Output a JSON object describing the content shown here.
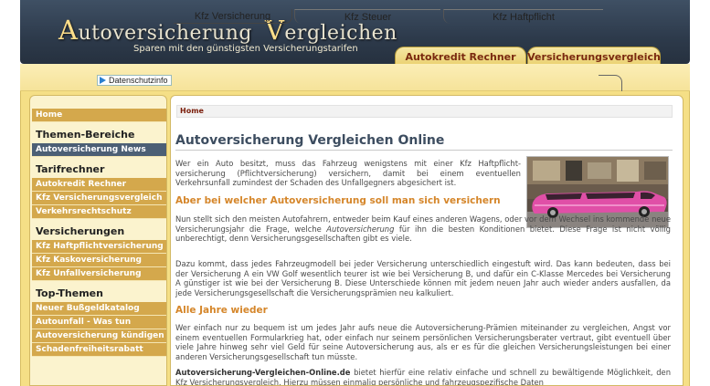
{
  "header": {
    "logo_title_a_initial": "A",
    "logo_title_a_rest": "utoversicherung",
    "logo_title_b_initial": "V",
    "logo_title_b_rest": "ergleichen",
    "logo_subtitle": "Sparen mit den günstigsten Versicherungstarifen",
    "tabs": [
      {
        "label": "Autokredit Rechner"
      },
      {
        "label": "Versicherungsvergleich"
      }
    ]
  },
  "nav": {
    "privacy_label": "Datenschutzinfo",
    "links": [
      {
        "label": "Kfz Versicherung"
      },
      {
        "label": "Kfz Steuer"
      },
      {
        "label": "Kfz Haftpflicht"
      }
    ]
  },
  "sidebar": {
    "home": "Home",
    "sections": [
      {
        "title": "Themen-Bereiche",
        "items": [
          {
            "label": "Autoversicherung News",
            "active": true
          }
        ]
      },
      {
        "title": "Tarifrechner",
        "items": [
          {
            "label": "Autokredit Rechner"
          },
          {
            "label": "Kfz Versicherungsvergleich"
          },
          {
            "label": "Verkehrsrechtschutz"
          }
        ]
      },
      {
        "title": "Versicherungen",
        "items": [
          {
            "label": "Kfz Haftpflichtversicherung"
          },
          {
            "label": "Kfz Kaskoversicherung"
          },
          {
            "label": "Kfz Unfallversicherung"
          }
        ]
      },
      {
        "title": "Top-Themen",
        "items": [
          {
            "label": "Neuer Bußgeldkatalog"
          },
          {
            "label": "Autounfall - Was tun"
          },
          {
            "label": "Autoversicherung kündigen"
          },
          {
            "label": "Schadenfreiheitsrabatt"
          }
        ]
      }
    ]
  },
  "main": {
    "breadcrumb": "Home",
    "title": "Autoversicherung Vergleichen Online",
    "paragraph_1": "Wer ein Auto besitzt, muss das Fahrzeug wenigstens mit einer Kfz Haftpflicht-versicherung (Pflichtversicherung) versichern, damit bei einem eventuellen Verkehrsunfall zumindest der Schaden des Unfallgegners abgesichert ist.",
    "heading_1": "Aber bei welcher Autoversicherung soll man sich versichern",
    "paragraph_2_a": "Nun stellt sich den meisten Autofahrern, entweder beim Kauf eines anderen Wagens, oder vor dem Wechsel ins kommende neue Versicherungsjahr die Frage, welche ",
    "paragraph_2_em": "Autoversicherung",
    "paragraph_2_b": " für ihn die besten Konditionen bietet. Diese Frage ist nicht völlig unberechtigt, denn Versicherungsgesellschaften gibt es viele.",
    "paragraph_3": "Dazu kommt, dass jedes Fahrzeugmodell bei jeder Versicherung unterschiedlich eingestuft wird. Das kann bedeuten, dass bei der Versicherung A ein VW Golf wesentlich teurer ist wie bei Versicherung B, und dafür ein C-Klasse Mercedes bei Versicherung A günstiger ist wie bei der Versicherung B. Diese Unterschiede können mit jedem neuen Jahr auch wieder anders ausfallen, da jede Versicherungsgesellschaft die Versicherungsprämien neu kalkuliert.",
    "heading_2": "Alle Jahre wieder",
    "paragraph_4": "Wer einfach nur zu bequem ist um jedes Jahr aufs neue die Autoversicherung-Prämien miteinander zu vergleichen, Angst vor einem eventuellen Formularkrieg hat, oder einfach nur seinem persönlichen Versicherungsberater vertraut, gibt eventuell über viele Jahre hinweg sehr viel Geld für seine Autoversicherung aus, als er es für die gleichen Versicherungsleistungen bei einer anderen Versicherungsgesellschaft tun müsste.",
    "paragraph_5_bold": "Autoversicherung-Vergleichen-Online.de",
    "paragraph_5_rest": " bietet hierfür eine relativ einfache und schnell zu bewältigende Möglichkeit, den Kfz Versicherungsvergleich. Hierzu müssen einmalig persönliche und fahrzeugspezifische Daten"
  },
  "colors": {
    "header_bg": "#2d3a4b",
    "logo_accent": "#ffdf8a",
    "gold": "#f5df86",
    "sidebar_link": "#d4a84c",
    "sidebar_active": "#4c5f75",
    "title_color": "#3d4d60",
    "heading_orange": "#d5862a",
    "crumb_red": "#7a1d0a"
  }
}
